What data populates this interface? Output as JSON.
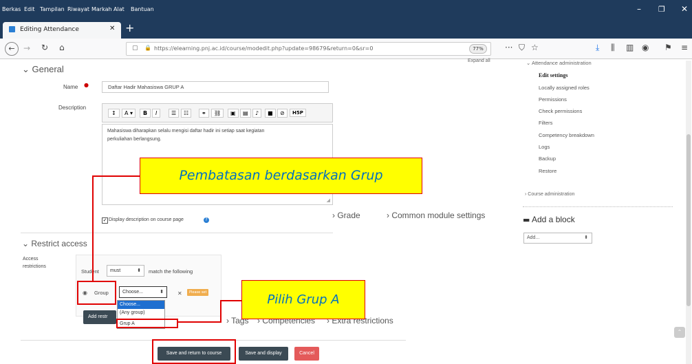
{
  "menubar": {
    "items": [
      "Berkas",
      "Edit",
      "Tampilan",
      "Riwayat",
      "Markah",
      "Alat",
      "Bantuan"
    ]
  },
  "tab": {
    "title": "Editing Attendance"
  },
  "url": {
    "text": "https://elearning.pnj.ac.id/course/modedit.php?update=98679&return=0&sr=0",
    "zoom": "77%"
  },
  "general": {
    "header": "General",
    "expand_all": "Expand all",
    "name_label": "Name",
    "name_value": "Daftar Hadir Mahasiswa GRUP A",
    "description_label": "Description",
    "description_text_line1": "Mahasiswa diharapkan selalu mengisi daftar hadir ini setiap saat kegiatan",
    "description_text_line2": "perkuliahan berlangsung.",
    "display_description": "Display description on course page"
  },
  "sections": {
    "grade": "Grade",
    "common": "Common module settings",
    "tags": "Tags",
    "competencies": "Competencies",
    "extra": "Extra restrictions"
  },
  "restrict": {
    "header": "Restrict access",
    "label_line1": "Access",
    "label_line2": "restrictions",
    "student": "Student",
    "must": "must",
    "match": "match the following",
    "group": "Group",
    "choose": "Choose...",
    "please_set": "Please set",
    "add_restriction": "Add restr",
    "dropdown_options": [
      "Choose...",
      "(Any group)",
      "Grup A"
    ]
  },
  "buttons": {
    "save_return": "Save and return to course",
    "save_display": "Save and display",
    "cancel": "Cancel"
  },
  "sidebar": {
    "admin_header": "Attendance administration",
    "links": [
      "Edit settings",
      "Locally assigned roles",
      "Permissions",
      "Check permissions",
      "Filters",
      "Competency breakdown",
      "Logs",
      "Backup",
      "Restore"
    ],
    "course_admin": "Course administration",
    "add_block": "Add a block",
    "add_select": "Add..."
  },
  "annotations": {
    "callout_group": "Pembatasan berdasarkan Grup",
    "callout_pilih": "Pilih Grup A"
  },
  "colors": {
    "titlebar": "#1f3b5c",
    "annotation_red": "#e00000",
    "callout_yellow": "#ffff00",
    "callout_text": "#0070c0",
    "cancel_red": "#e45a5a",
    "button_dark": "#3b4a54"
  }
}
